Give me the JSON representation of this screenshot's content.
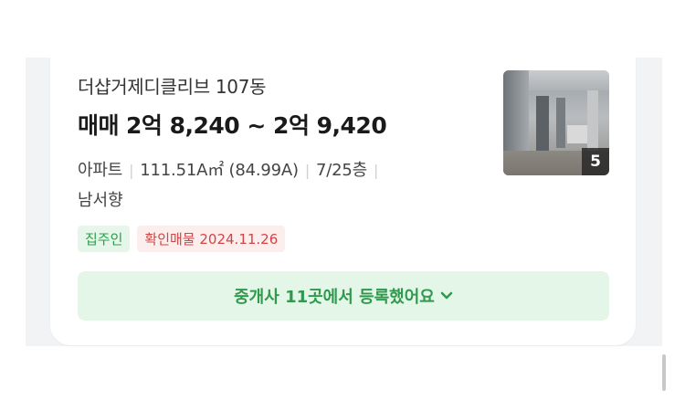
{
  "listing": {
    "title": "더샵거제디클리브 107동",
    "deal_type": "매매",
    "price_range": "2억 8,240 ~ 2억 9,420",
    "property_type": "아파트",
    "area": "111.51A㎡ (84.99A)",
    "floor": "7/25층",
    "direction": "남서향",
    "badges": {
      "owner": "집주인",
      "verified": "확인매물 2024.11.26"
    },
    "photo_count": "5",
    "agents_button": "중개사 11곳에서 등록했어요"
  },
  "colors": {
    "accent_green": "#2f9a4d",
    "green_bg": "#e4f6e8",
    "verified_red": "#d04545",
    "verified_bg": "#fdeeee"
  },
  "icons": {
    "expand": "chevron-down-icon",
    "photo": "room-photo-thumbnail"
  }
}
